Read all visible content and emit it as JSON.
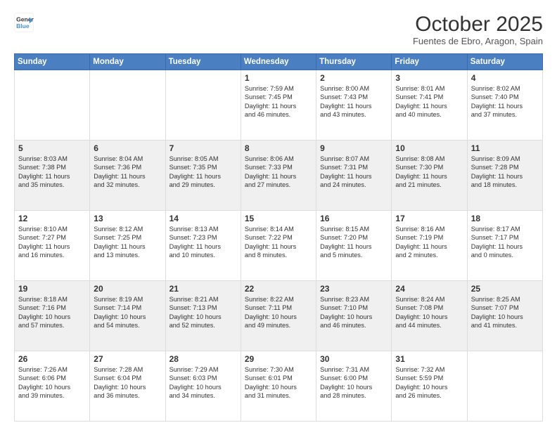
{
  "header": {
    "logo_general": "General",
    "logo_blue": "Blue",
    "month": "October 2025",
    "location": "Fuentes de Ebro, Aragon, Spain"
  },
  "weekdays": [
    "Sunday",
    "Monday",
    "Tuesday",
    "Wednesday",
    "Thursday",
    "Friday",
    "Saturday"
  ],
  "weeks": [
    [
      {
        "day": "",
        "text": ""
      },
      {
        "day": "",
        "text": ""
      },
      {
        "day": "",
        "text": ""
      },
      {
        "day": "1",
        "text": "Sunrise: 7:59 AM\nSunset: 7:45 PM\nDaylight: 11 hours\nand 46 minutes."
      },
      {
        "day": "2",
        "text": "Sunrise: 8:00 AM\nSunset: 7:43 PM\nDaylight: 11 hours\nand 43 minutes."
      },
      {
        "day": "3",
        "text": "Sunrise: 8:01 AM\nSunset: 7:41 PM\nDaylight: 11 hours\nand 40 minutes."
      },
      {
        "day": "4",
        "text": "Sunrise: 8:02 AM\nSunset: 7:40 PM\nDaylight: 11 hours\nand 37 minutes."
      }
    ],
    [
      {
        "day": "5",
        "text": "Sunrise: 8:03 AM\nSunset: 7:38 PM\nDaylight: 11 hours\nand 35 minutes."
      },
      {
        "day": "6",
        "text": "Sunrise: 8:04 AM\nSunset: 7:36 PM\nDaylight: 11 hours\nand 32 minutes."
      },
      {
        "day": "7",
        "text": "Sunrise: 8:05 AM\nSunset: 7:35 PM\nDaylight: 11 hours\nand 29 minutes."
      },
      {
        "day": "8",
        "text": "Sunrise: 8:06 AM\nSunset: 7:33 PM\nDaylight: 11 hours\nand 27 minutes."
      },
      {
        "day": "9",
        "text": "Sunrise: 8:07 AM\nSunset: 7:31 PM\nDaylight: 11 hours\nand 24 minutes."
      },
      {
        "day": "10",
        "text": "Sunrise: 8:08 AM\nSunset: 7:30 PM\nDaylight: 11 hours\nand 21 minutes."
      },
      {
        "day": "11",
        "text": "Sunrise: 8:09 AM\nSunset: 7:28 PM\nDaylight: 11 hours\nand 18 minutes."
      }
    ],
    [
      {
        "day": "12",
        "text": "Sunrise: 8:10 AM\nSunset: 7:27 PM\nDaylight: 11 hours\nand 16 minutes."
      },
      {
        "day": "13",
        "text": "Sunrise: 8:12 AM\nSunset: 7:25 PM\nDaylight: 11 hours\nand 13 minutes."
      },
      {
        "day": "14",
        "text": "Sunrise: 8:13 AM\nSunset: 7:23 PM\nDaylight: 11 hours\nand 10 minutes."
      },
      {
        "day": "15",
        "text": "Sunrise: 8:14 AM\nSunset: 7:22 PM\nDaylight: 11 hours\nand 8 minutes."
      },
      {
        "day": "16",
        "text": "Sunrise: 8:15 AM\nSunset: 7:20 PM\nDaylight: 11 hours\nand 5 minutes."
      },
      {
        "day": "17",
        "text": "Sunrise: 8:16 AM\nSunset: 7:19 PM\nDaylight: 11 hours\nand 2 minutes."
      },
      {
        "day": "18",
        "text": "Sunrise: 8:17 AM\nSunset: 7:17 PM\nDaylight: 11 hours\nand 0 minutes."
      }
    ],
    [
      {
        "day": "19",
        "text": "Sunrise: 8:18 AM\nSunset: 7:16 PM\nDaylight: 10 hours\nand 57 minutes."
      },
      {
        "day": "20",
        "text": "Sunrise: 8:19 AM\nSunset: 7:14 PM\nDaylight: 10 hours\nand 54 minutes."
      },
      {
        "day": "21",
        "text": "Sunrise: 8:21 AM\nSunset: 7:13 PM\nDaylight: 10 hours\nand 52 minutes."
      },
      {
        "day": "22",
        "text": "Sunrise: 8:22 AM\nSunset: 7:11 PM\nDaylight: 10 hours\nand 49 minutes."
      },
      {
        "day": "23",
        "text": "Sunrise: 8:23 AM\nSunset: 7:10 PM\nDaylight: 10 hours\nand 46 minutes."
      },
      {
        "day": "24",
        "text": "Sunrise: 8:24 AM\nSunset: 7:08 PM\nDaylight: 10 hours\nand 44 minutes."
      },
      {
        "day": "25",
        "text": "Sunrise: 8:25 AM\nSunset: 7:07 PM\nDaylight: 10 hours\nand 41 minutes."
      }
    ],
    [
      {
        "day": "26",
        "text": "Sunrise: 7:26 AM\nSunset: 6:06 PM\nDaylight: 10 hours\nand 39 minutes."
      },
      {
        "day": "27",
        "text": "Sunrise: 7:28 AM\nSunset: 6:04 PM\nDaylight: 10 hours\nand 36 minutes."
      },
      {
        "day": "28",
        "text": "Sunrise: 7:29 AM\nSunset: 6:03 PM\nDaylight: 10 hours\nand 34 minutes."
      },
      {
        "day": "29",
        "text": "Sunrise: 7:30 AM\nSunset: 6:01 PM\nDaylight: 10 hours\nand 31 minutes."
      },
      {
        "day": "30",
        "text": "Sunrise: 7:31 AM\nSunset: 6:00 PM\nDaylight: 10 hours\nand 28 minutes."
      },
      {
        "day": "31",
        "text": "Sunrise: 7:32 AM\nSunset: 5:59 PM\nDaylight: 10 hours\nand 26 minutes."
      },
      {
        "day": "",
        "text": ""
      }
    ]
  ]
}
